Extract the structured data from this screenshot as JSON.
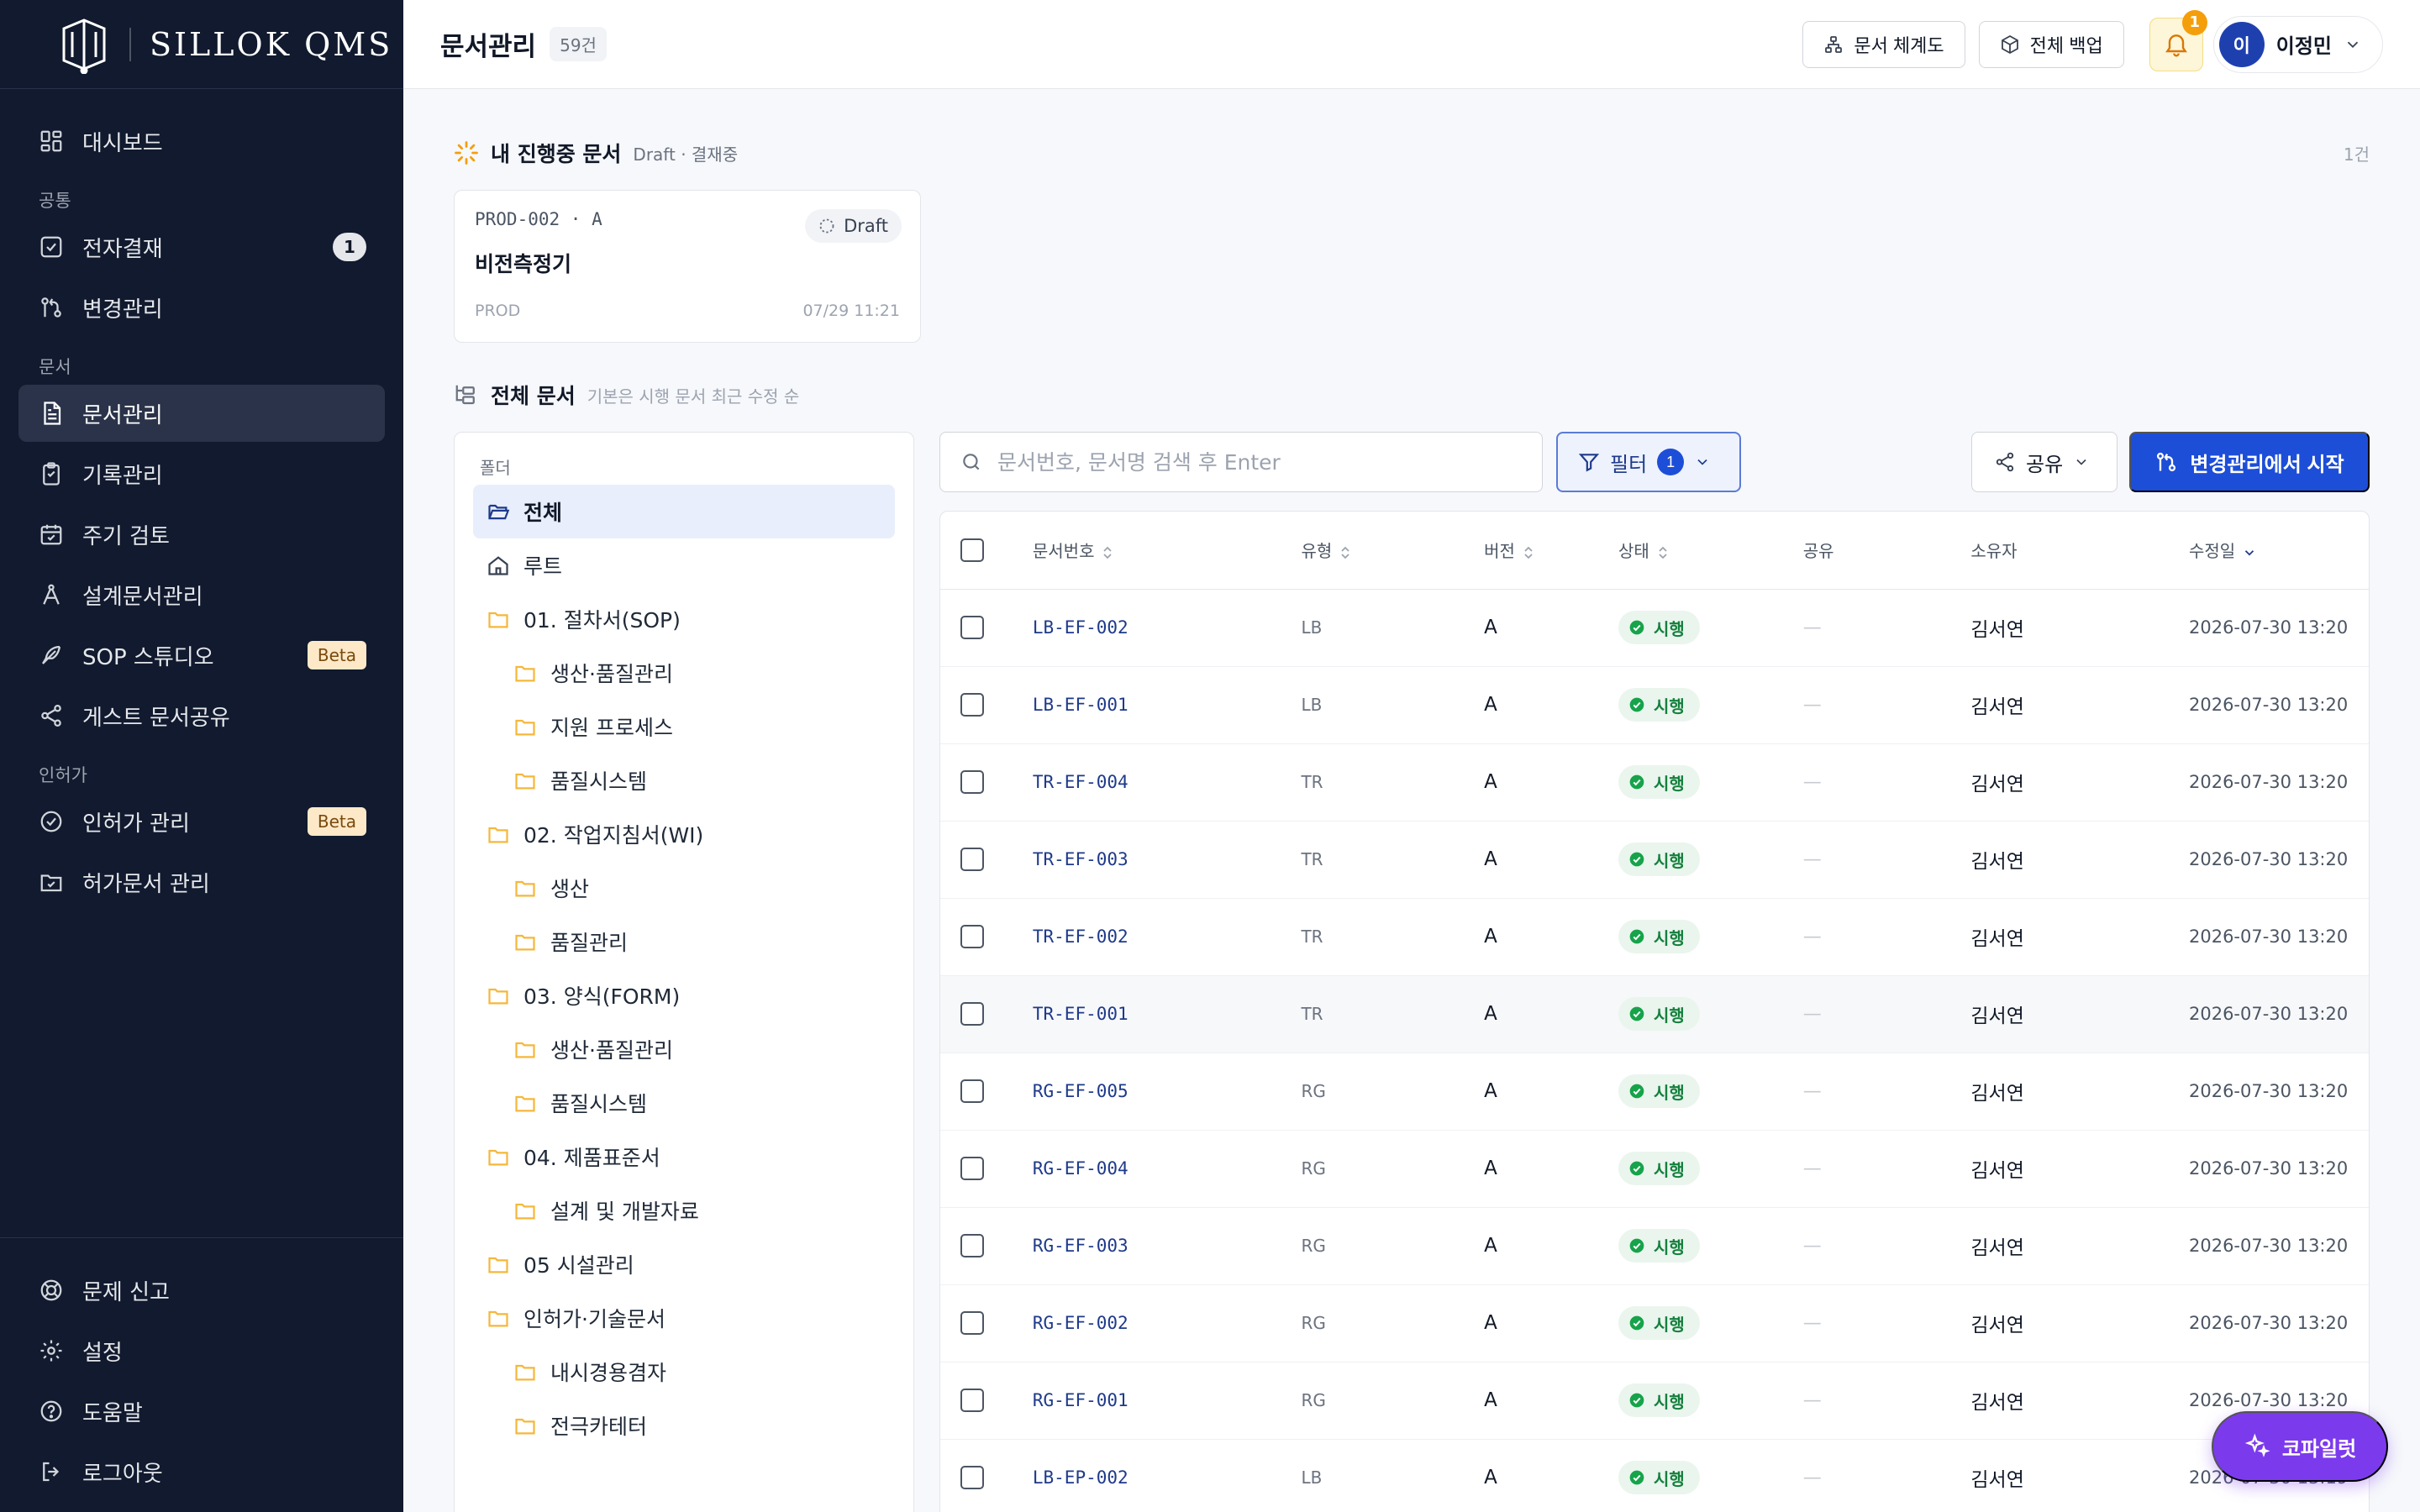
{
  "brand": {
    "name": "SILLOK QMS"
  },
  "sidebar": {
    "dashboard": "대시보드",
    "sections": {
      "common": "공통",
      "docs": "문서",
      "license": "인허가"
    },
    "items": {
      "approval": "전자결재",
      "approval_badge": "1",
      "change": "변경관리",
      "doc_mgmt": "문서관리",
      "records": "기록관리",
      "periodic": "주기 검토",
      "design": "설계문서관리",
      "sop_studio": "SOP 스튜디오",
      "sop_beta": "Beta",
      "guest_share": "게스트 문서공유",
      "license_mgmt": "인허가 관리",
      "license_beta": "Beta",
      "permit_docs": "허가문서 관리"
    },
    "bottom": {
      "report": "문제 신고",
      "settings": "설정",
      "help": "도움말",
      "logout": "로그아웃"
    }
  },
  "header": {
    "title": "문서관리",
    "count": "59건",
    "hierarchy_btn": "문서 체계도",
    "backup_btn": "전체 백업",
    "notif_count": "1",
    "user_initial": "이",
    "user_name": "이정민"
  },
  "inprogress": {
    "title": "내 진행중 문서",
    "subtitle": "Draft · 결재중",
    "count": "1건",
    "card": {
      "code": "PROD-002 · A",
      "status": "Draft",
      "title": "비전측정기",
      "category": "PROD",
      "date": "07/29 11:21"
    }
  },
  "all_docs": {
    "title": "전체 문서",
    "subtitle": "기본은 시행 문서 최근 수정 순"
  },
  "folders": {
    "header": "폴더",
    "items": [
      {
        "label": "전체",
        "level": 1,
        "icon": "folder-open-icon"
      },
      {
        "label": "루트",
        "level": 1,
        "icon": "home-icon"
      },
      {
        "label": "01. 절차서(SOP)",
        "level": 1,
        "icon": "folder-icon"
      },
      {
        "label": "생산·품질관리",
        "level": 2,
        "icon": "folder-icon"
      },
      {
        "label": "지원 프로세스",
        "level": 2,
        "icon": "folder-icon"
      },
      {
        "label": "품질시스템",
        "level": 2,
        "icon": "folder-icon"
      },
      {
        "label": "02. 작업지침서(WI)",
        "level": 1,
        "icon": "folder-icon"
      },
      {
        "label": "생산",
        "level": 2,
        "icon": "folder-icon"
      },
      {
        "label": "품질관리",
        "level": 2,
        "icon": "folder-icon"
      },
      {
        "label": "03. 양식(FORM)",
        "level": 1,
        "icon": "folder-icon"
      },
      {
        "label": "생산·품질관리",
        "level": 2,
        "icon": "folder-icon"
      },
      {
        "label": "품질시스템",
        "level": 2,
        "icon": "folder-icon"
      },
      {
        "label": "04. 제품표준서",
        "level": 1,
        "icon": "folder-icon"
      },
      {
        "label": "설계 및 개발자료",
        "level": 2,
        "icon": "folder-icon"
      },
      {
        "label": "05 시설관리",
        "level": 1,
        "icon": "folder-icon"
      },
      {
        "label": "인허가·기술문서",
        "level": 1,
        "icon": "folder-icon"
      },
      {
        "label": "내시경용겸자",
        "level": 2,
        "icon": "folder-icon"
      },
      {
        "label": "전극카테터",
        "level": 2,
        "icon": "folder-icon"
      }
    ]
  },
  "toolbar": {
    "search_placeholder": "문서번호, 문서명 검색 후 Enter",
    "filter_label": "필터",
    "filter_count": "1",
    "share_label": "공유",
    "primary_label": "변경관리에서 시작"
  },
  "table": {
    "headers": {
      "doc_no": "문서번호",
      "type": "유형",
      "version": "버전",
      "status": "상태",
      "share": "공유",
      "owner": "소유자",
      "modified": "수정일"
    },
    "rows": [
      {
        "doc_no": "LB-EF-002",
        "type": "LB",
        "version": "A",
        "status": "시행",
        "share": "—",
        "owner": "김서연",
        "modified": "2026-07-30 13:20"
      },
      {
        "doc_no": "LB-EF-001",
        "type": "LB",
        "version": "A",
        "status": "시행",
        "share": "—",
        "owner": "김서연",
        "modified": "2026-07-30 13:20"
      },
      {
        "doc_no": "TR-EF-004",
        "type": "TR",
        "version": "A",
        "status": "시행",
        "share": "—",
        "owner": "김서연",
        "modified": "2026-07-30 13:20"
      },
      {
        "doc_no": "TR-EF-003",
        "type": "TR",
        "version": "A",
        "status": "시행",
        "share": "—",
        "owner": "김서연",
        "modified": "2026-07-30 13:20"
      },
      {
        "doc_no": "TR-EF-002",
        "type": "TR",
        "version": "A",
        "status": "시행",
        "share": "—",
        "owner": "김서연",
        "modified": "2026-07-30 13:20"
      },
      {
        "doc_no": "TR-EF-001",
        "type": "TR",
        "version": "A",
        "status": "시행",
        "share": "—",
        "owner": "김서연",
        "modified": "2026-07-30 13:20"
      },
      {
        "doc_no": "RG-EF-005",
        "type": "RG",
        "version": "A",
        "status": "시행",
        "share": "—",
        "owner": "김서연",
        "modified": "2026-07-30 13:20"
      },
      {
        "doc_no": "RG-EF-004",
        "type": "RG",
        "version": "A",
        "status": "시행",
        "share": "—",
        "owner": "김서연",
        "modified": "2026-07-30 13:20"
      },
      {
        "doc_no": "RG-EF-003",
        "type": "RG",
        "version": "A",
        "status": "시행",
        "share": "—",
        "owner": "김서연",
        "modified": "2026-07-30 13:20"
      },
      {
        "doc_no": "RG-EF-002",
        "type": "RG",
        "version": "A",
        "status": "시행",
        "share": "—",
        "owner": "김서연",
        "modified": "2026-07-30 13:20"
      },
      {
        "doc_no": "RG-EF-001",
        "type": "RG",
        "version": "A",
        "status": "시행",
        "share": "—",
        "owner": "김서연",
        "modified": "2026-07-30 13:20"
      },
      {
        "doc_no": "LB-EP-002",
        "type": "LB",
        "version": "A",
        "status": "시행",
        "share": "—",
        "owner": "김서연",
        "modified": "2026-07-30 13:19"
      }
    ]
  },
  "copilot": {
    "label": "코파일럿"
  },
  "colors": {
    "sidebar_bg": "#111a2e",
    "primary": "#1d4ed8",
    "status_green": "#16a34a",
    "copilot": "#7c3aed",
    "folder": "#f5b73b"
  }
}
